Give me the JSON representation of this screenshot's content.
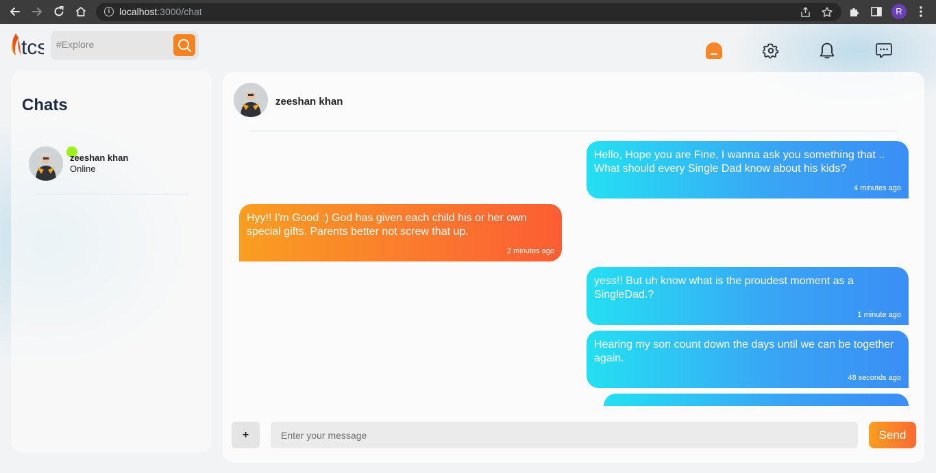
{
  "browser": {
    "url_host": "localhost",
    "url_path": ":3000/chat",
    "profile_initial": "R"
  },
  "header": {
    "search_placeholder": "#Explore"
  },
  "sidebar": {
    "title": "Chats",
    "chats": [
      {
        "name": "zeeshan khan",
        "status": "Online"
      }
    ]
  },
  "conversation": {
    "contact_name": "zeeshan khan",
    "messages": [
      {
        "text": "Hello, Hope you are Fine, I wanna ask you something that .. What should every Single Dad know about his kids?",
        "time": "4 minutes ago",
        "own": true
      },
      {
        "text": "Hyy!! I'm Good :) God has given each child his or her own special gifts. Parents better not screw that up.",
        "time": "2 minutes ago",
        "own": false
      },
      {
        "text": "yess!! But uh know what is the proudest moment as a SingleDad.?",
        "time": "1 minute ago",
        "own": true
      },
      {
        "text": "Hearing my son count down the days until we can be together again.",
        "time": "48 seconds ago",
        "own": true
      }
    ],
    "input_placeholder": "Enter your message",
    "attach_label": "+",
    "send_label": "Send"
  },
  "colors": {
    "accent_orange": "#f4821f",
    "own_bubble_start": "#24e0f2",
    "own_bubble_end": "#3a8ef5",
    "other_bubble_start": "#f99e21",
    "other_bubble_end": "#fb5d33",
    "online_dot": "#9ef01a"
  },
  "icons": {
    "browser": [
      "back-arrow-icon",
      "forward-arrow-icon",
      "reload-icon",
      "home-icon",
      "info-icon",
      "share-icon",
      "star-icon",
      "puzzle-icon",
      "side-panel-icon",
      "kebab-menu-icon"
    ],
    "app": [
      "search-icon",
      "home-blob-icon",
      "gear-icon",
      "bell-icon",
      "chat-bubble-icon"
    ]
  }
}
